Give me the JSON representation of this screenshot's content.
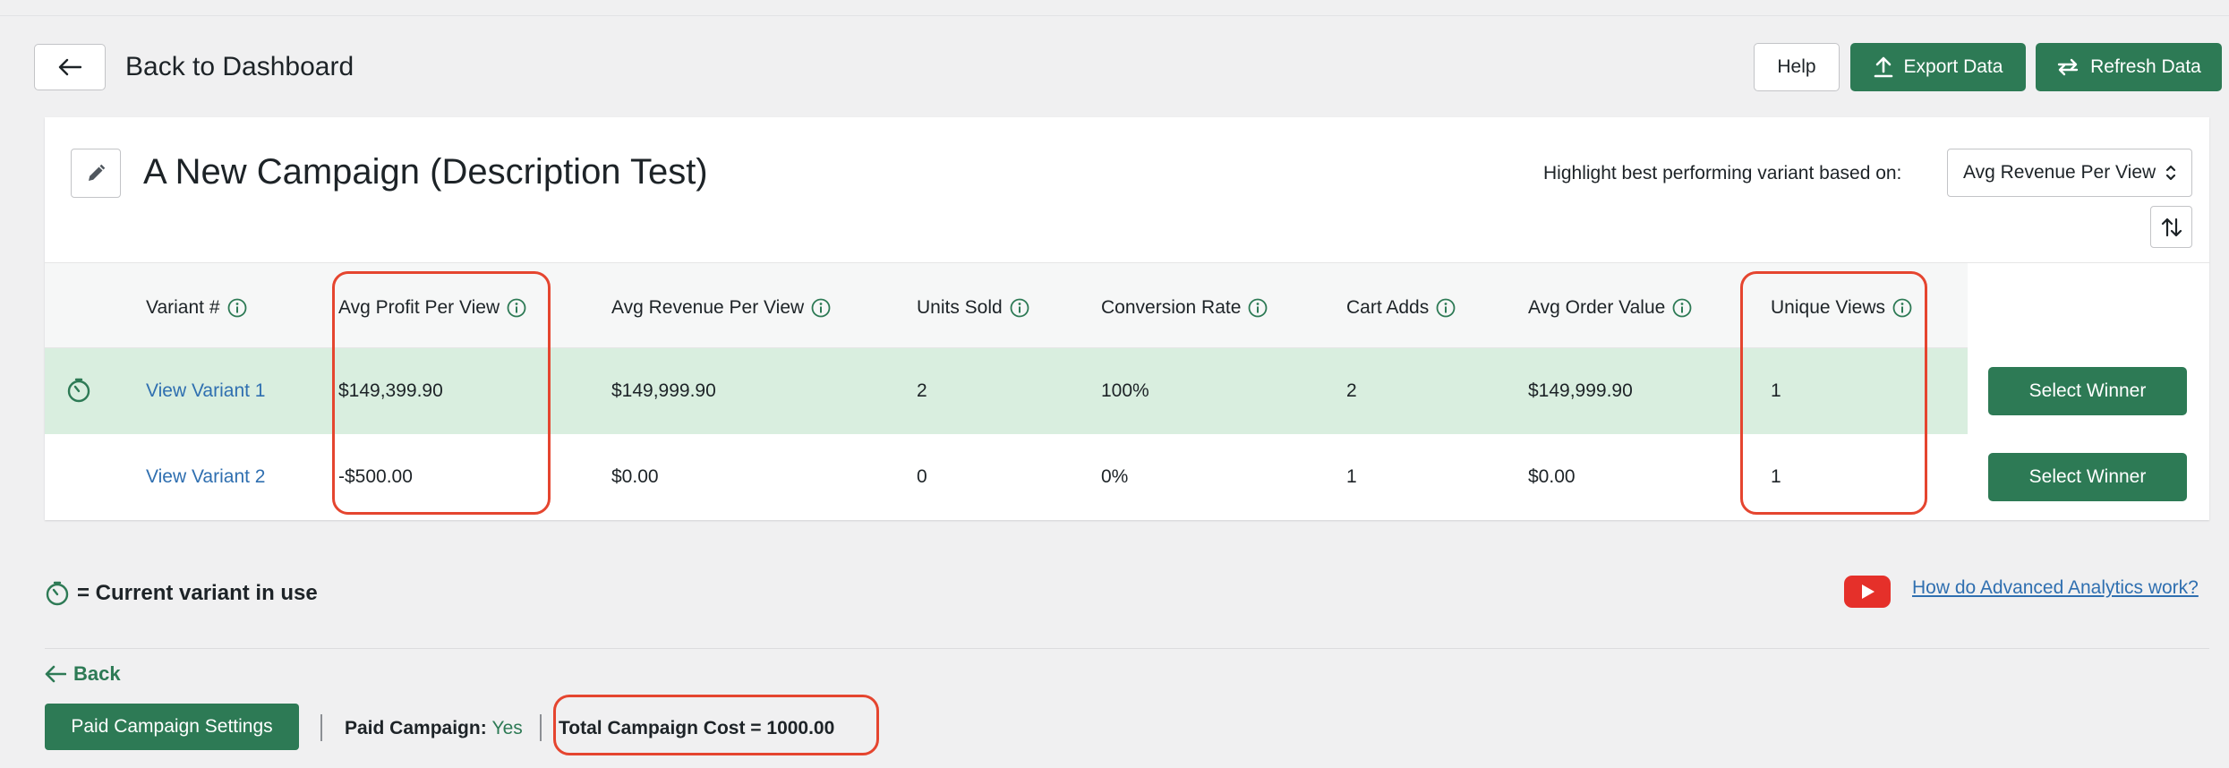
{
  "header": {
    "back_title": "Back to Dashboard",
    "help_label": "Help",
    "export_label": "Export Data",
    "refresh_label": "Refresh Data"
  },
  "campaign": {
    "title": "A New Campaign (Description Test)",
    "highlight_label": "Highlight best performing variant based on:",
    "highlight_selected": "Avg Revenue Per View"
  },
  "table": {
    "columns": [
      "Variant #",
      "Avg Profit Per View",
      "Avg Revenue Per View",
      "Units Sold",
      "Conversion Rate",
      "Cart Adds",
      "Avg Order Value",
      "Unique Views"
    ],
    "rows": [
      {
        "variant": "View Variant 1",
        "avg_profit": "$149,399.90",
        "avg_revenue": "$149,999.90",
        "units_sold": "2",
        "conversion_rate": "100%",
        "cart_adds": "2",
        "avg_order_value": "$149,999.90",
        "unique_views": "1",
        "action": "Select Winner"
      },
      {
        "variant": "View Variant 2",
        "avg_profit": "-$500.00",
        "avg_revenue": "$0.00",
        "units_sold": "0",
        "conversion_rate": "0%",
        "cart_adds": "1",
        "avg_order_value": "$0.00",
        "unique_views": "1",
        "action": "Select Winner"
      }
    ]
  },
  "legend": {
    "text": "= Current variant in use"
  },
  "help_link": "How do Advanced Analytics work?",
  "footer": {
    "back_label": "Back",
    "paid_settings_label": "Paid Campaign Settings",
    "paid_campaign_label": "Paid Campaign:",
    "paid_campaign_value": "Yes",
    "total_cost": "Total Campaign Cost = 1000.00"
  },
  "colors": {
    "accent": "#2d7a55",
    "highlight_row": "#d9eedf",
    "link": "#2f6fb0",
    "annotation": "#e5452f"
  }
}
